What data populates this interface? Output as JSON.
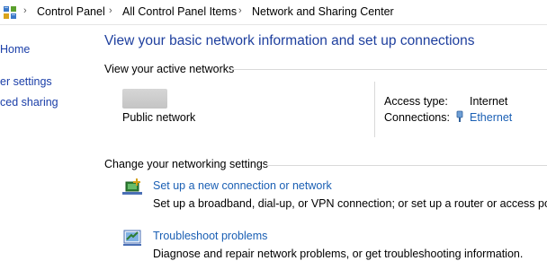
{
  "breadcrumb": {
    "items": [
      "Control Panel",
      "All Control Panel Items",
      "Network and Sharing Center"
    ],
    "separator": "›"
  },
  "leftnav": {
    "items": [
      "Home",
      "er settings",
      "ced sharing"
    ]
  },
  "main": {
    "title": "View your basic network information and set up connections",
    "active_networks_header": "View your active networks",
    "network": {
      "name": "Public network",
      "access_type_label": "Access type:",
      "access_type_value": "Internet",
      "connections_label": "Connections:",
      "connections_value": "Ethernet"
    },
    "change_settings_header": "Change your networking settings",
    "tasks": [
      {
        "link": "Set up a new connection or network",
        "desc": "Set up a broadband, dial-up, or VPN connection; or set up a router or access point.",
        "icon": "new-connection-icon"
      },
      {
        "link": "Troubleshoot problems",
        "desc": "Diagnose and repair network problems, or get troubleshooting information.",
        "icon": "troubleshoot-icon"
      }
    ]
  },
  "colors": {
    "title_blue": "#1e3f9e",
    "link_blue": "#1a5fb4",
    "nav_blue": "#1a3ea8",
    "rule_gray": "#d9d9d9"
  }
}
